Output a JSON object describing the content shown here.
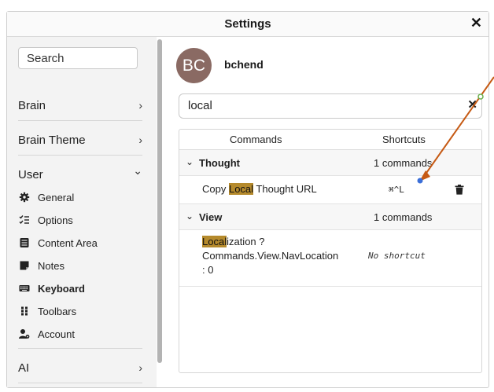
{
  "window": {
    "title": "Settings",
    "close_label": "✕"
  },
  "sidebar": {
    "search_placeholder": "Search",
    "sections": [
      {
        "label": "Brain",
        "chevron": "›"
      },
      {
        "label": "Brain Theme",
        "chevron": "›"
      },
      {
        "label": "User",
        "chevron": "⌄"
      },
      {
        "label": "AI",
        "chevron": "›"
      }
    ],
    "user_items": [
      {
        "label": "General",
        "icon": "gear-icon"
      },
      {
        "label": "Options",
        "icon": "checklist-icon"
      },
      {
        "label": "Content Area",
        "icon": "document-icon"
      },
      {
        "label": "Notes",
        "icon": "note-icon"
      },
      {
        "label": "Keyboard",
        "icon": "keyboard-icon",
        "active": true
      },
      {
        "label": "Toolbars",
        "icon": "grid-dots-icon"
      },
      {
        "label": "Account",
        "icon": "account-gear-icon"
      }
    ]
  },
  "profile": {
    "initials": "BC",
    "username": "bchend",
    "avatar_color": "#8a6a63"
  },
  "search": {
    "value": "local",
    "clear_label": "✕"
  },
  "table": {
    "col_commands": "Commands",
    "col_shortcuts": "Shortcuts",
    "groups": [
      {
        "name": "Thought",
        "count": "1 commands",
        "rows": [
          {
            "cmd_pre": "Copy ",
            "cmd_hl": "Local",
            "cmd_post": " Thought URL",
            "shortcut": "⌘^L"
          }
        ]
      },
      {
        "name": "View",
        "count": "1 commands",
        "rows": [
          {
            "cmd_hl": "Local",
            "line1_post": "ization ?",
            "line2": "Commands.View.NavLocation",
            "line3": ": 0",
            "shortcut": "No shortcut"
          }
        ]
      }
    ]
  },
  "colors": {
    "highlight": "#b58a2c",
    "annotation_arrow": "#c65a14",
    "annotation_dot": "#3b6fd8"
  }
}
